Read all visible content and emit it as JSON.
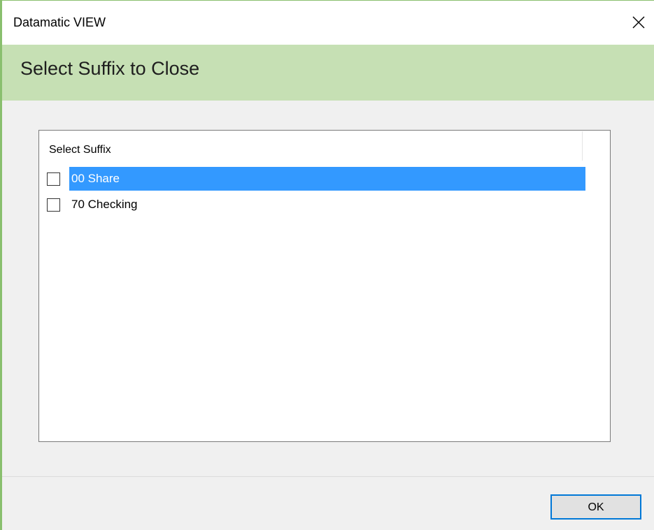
{
  "window": {
    "title": "Datamatic VIEW",
    "close_icon": "close-icon"
  },
  "header": {
    "title": "Select Suffix to Close"
  },
  "list": {
    "column_header": "Select Suffix",
    "items": [
      {
        "label": "00 Share",
        "checked": false,
        "selected": true
      },
      {
        "label": "70 Checking",
        "checked": false,
        "selected": false
      }
    ]
  },
  "footer": {
    "ok_label": "OK"
  },
  "colors": {
    "accent_border": "#89bf6e",
    "header_band": "#c6e0b4",
    "selection": "#3399ff",
    "focus_border": "#0078d7"
  }
}
